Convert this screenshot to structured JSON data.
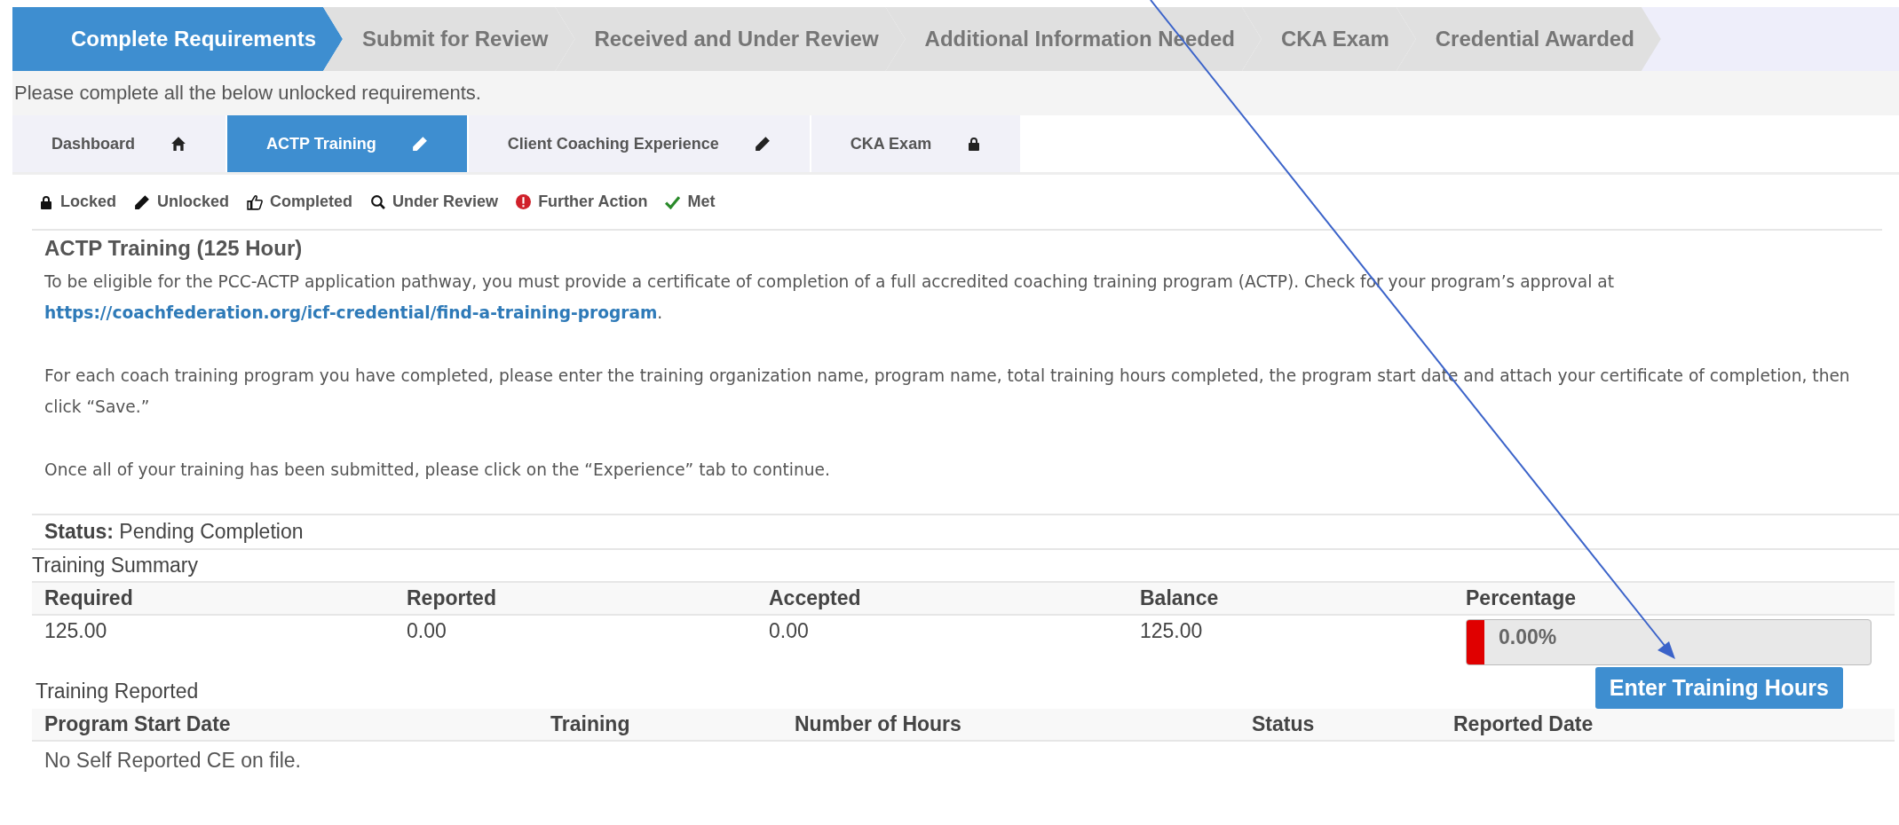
{
  "steps": [
    {
      "label": "Complete Requirements",
      "selected": true
    },
    {
      "label": "Submit for Review",
      "selected": false
    },
    {
      "label": "Received and Under Review",
      "selected": false
    },
    {
      "label": "Additional Information Needed",
      "selected": false
    },
    {
      "label": "CKA Exam",
      "selected": false
    },
    {
      "label": "Credential Awarded",
      "selected": false
    }
  ],
  "instruction": "Please complete all the below unlocked requirements.",
  "tabs": [
    {
      "label": "Dashboard",
      "kind": "home",
      "selected": false
    },
    {
      "label": "ACTP Training",
      "kind": "unlocked",
      "selected": true
    },
    {
      "label": "Client Coaching Experience",
      "kind": "unlocked",
      "selected": false
    },
    {
      "label": "CKA Exam",
      "kind": "locked",
      "selected": false
    }
  ],
  "legend": [
    {
      "label": "Locked",
      "kind": "locked"
    },
    {
      "label": "Unlocked",
      "kind": "unlocked"
    },
    {
      "label": "Completed",
      "kind": "completed"
    },
    {
      "label": "Under Review",
      "kind": "review"
    },
    {
      "label": "Further Action",
      "kind": "action"
    },
    {
      "label": "Met",
      "kind": "met"
    }
  ],
  "section": {
    "title": "ACTP Training (125 Hour)",
    "intro": "To be eligible for the PCC-ACTP application pathway, you must provide a certificate of completion of a full accredited coaching training program (ACTP). Check for your program’s approval at",
    "link": "https://coachfederation.org/icf-credential/find-a-training-program",
    "intro_end": ".",
    "paragraphs": [
      "For each coach training program you have completed, please enter the training organization name, program name, total training hours completed, the program start date and attach your certificate of completion, then click “Save.”",
      "Once all of your training has been submitted, please click on the “Experience” tab to continue."
    ]
  },
  "status": {
    "label": "Status:",
    "value": "Pending Completion"
  },
  "summary": {
    "title": "Training Summary",
    "columns": [
      "Required",
      "Reported",
      "Accepted",
      "Balance",
      "Percentage"
    ],
    "values": [
      "125.00",
      "0.00",
      "0.00",
      "125.00"
    ],
    "percentage": {
      "text": "0.00%",
      "level": 0
    }
  },
  "reported": {
    "title": "Training Reported",
    "button": "Enter Training Hours",
    "columns": [
      "Program Start Date",
      "Training",
      "Number of Hours",
      "Status",
      "Reported Date"
    ],
    "empty": "No Self Reported CE on file."
  }
}
